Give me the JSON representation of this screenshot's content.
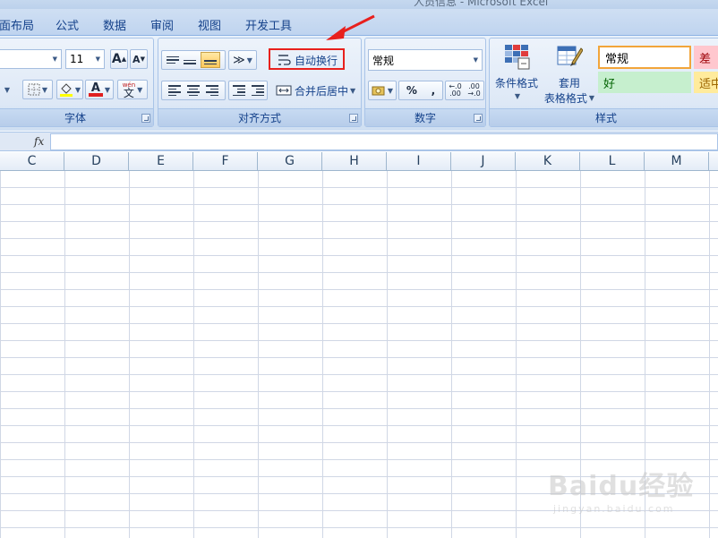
{
  "window": {
    "title": "人员信息 - Microsoft Excel"
  },
  "tabs": [
    {
      "label": "页面布局"
    },
    {
      "label": "公式"
    },
    {
      "label": "数据"
    },
    {
      "label": "审阅"
    },
    {
      "label": "视图"
    },
    {
      "label": "开发工具"
    }
  ],
  "font_group": {
    "title": "字体",
    "font_size": "11",
    "grow_font_glyph": "A",
    "shrink_font_glyph": "A",
    "wen_glyph": "wén",
    "wen_char": "文",
    "font_color_glyph": "A",
    "font_color": "#e02020"
  },
  "alignment_group": {
    "title": "对齐方式",
    "wrap_text": "自动换行",
    "merge_center": "合并后居中"
  },
  "number_group": {
    "title": "数字",
    "format": "常规",
    "percent": "%",
    "comma": ",",
    "inc_decimal": "←.0 .00",
    "dec_decimal": ".00 →.0"
  },
  "styles_group": {
    "title": "样式",
    "conditional_format": "条件格式",
    "table_style_line1": "套用",
    "table_style_line2": "表格格式",
    "style_normal": "常规",
    "style_bad": "差",
    "style_good": "好",
    "style_neutral": "适中",
    "colors": {
      "normal_border": "#f2a53a",
      "bad_bg": "#ffc7ce",
      "bad_fg": "#9c0006",
      "good_bg": "#c6efce",
      "good_fg": "#006100",
      "neutral_bg": "#ffeb9c",
      "neutral_fg": "#9c6500"
    }
  },
  "formula_bar": {
    "fx_label": "fx",
    "value": ""
  },
  "columns": [
    "C",
    "D",
    "E",
    "F",
    "G",
    "H",
    "I",
    "J",
    "K",
    "L",
    "M"
  ],
  "watermark": {
    "main": "Baidu经验",
    "sub": "jingyan.baidu.com"
  },
  "annotation": {
    "color": "#e8201d"
  }
}
